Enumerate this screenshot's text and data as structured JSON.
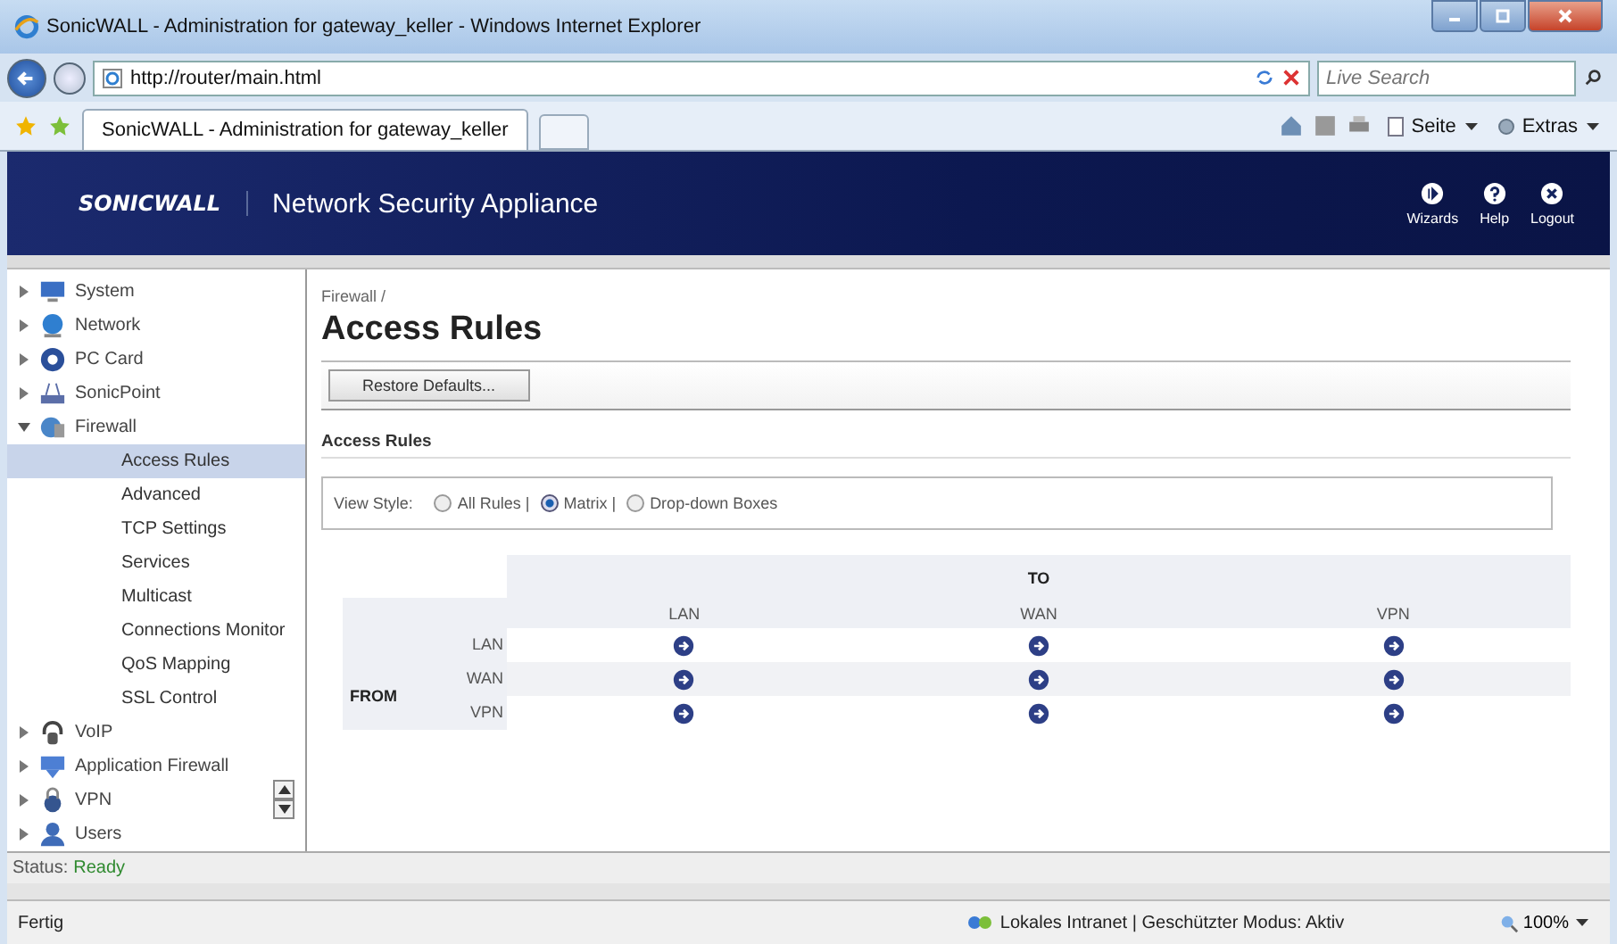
{
  "window": {
    "title": "SonicWALL - Administration for gateway_keller - Windows Internet Explorer"
  },
  "address_bar": {
    "url": "http://router/main.html",
    "search_placeholder": "Live Search"
  },
  "tab": {
    "label": "SonicWALL - Administration for gateway_keller"
  },
  "toolbar": {
    "items": [
      {
        "label": "Seite",
        "kind": "page"
      },
      {
        "label": "Extras",
        "kind": "tools"
      }
    ]
  },
  "app_header": {
    "logo": "SONICWALL",
    "product": "Network Security Appliance",
    "actions": [
      {
        "label": "Wizards",
        "kind": "wizard"
      },
      {
        "label": "Help",
        "kind": "help"
      },
      {
        "label": "Logout",
        "kind": "logout"
      }
    ]
  },
  "sidebar": {
    "items": [
      {
        "label": "System",
        "kind": "monitor",
        "expanded": false,
        "selected": false
      },
      {
        "label": "Network",
        "kind": "globe",
        "expanded": false,
        "selected": false
      },
      {
        "label": "PC Card",
        "kind": "card",
        "expanded": false,
        "selected": false
      },
      {
        "label": "SonicPoint",
        "kind": "router",
        "expanded": false,
        "selected": false
      },
      {
        "label": "Firewall",
        "kind": "wall",
        "expanded": true,
        "selected": false,
        "children": [
          {
            "label": "Access Rules",
            "selected": true
          },
          {
            "label": "Advanced",
            "selected": false
          },
          {
            "label": "TCP Settings",
            "selected": false
          },
          {
            "label": "Services",
            "selected": false
          },
          {
            "label": "Multicast",
            "selected": false
          },
          {
            "label": "Connections Monitor",
            "selected": false
          },
          {
            "label": "QoS Mapping",
            "selected": false
          },
          {
            "label": "SSL Control",
            "selected": false
          }
        ]
      },
      {
        "label": "VoIP",
        "kind": "headset",
        "expanded": false,
        "selected": false
      },
      {
        "label": "Application Firewall",
        "kind": "shield",
        "expanded": false,
        "selected": false
      },
      {
        "label": "VPN",
        "kind": "lock",
        "expanded": false,
        "selected": false
      },
      {
        "label": "Users",
        "kind": "users",
        "expanded": false,
        "selected": false
      }
    ]
  },
  "main": {
    "breadcrumb": "Firewall /",
    "title": "Access Rules",
    "restore_button": "Restore Defaults...",
    "section": "Access Rules",
    "view_style": {
      "label": "View Style:",
      "options": [
        {
          "label": "All Rules |",
          "selected": false
        },
        {
          "label": "Matrix |",
          "selected": true
        },
        {
          "label": "Drop-down Boxes",
          "selected": false
        }
      ]
    },
    "matrix": {
      "to_label": "TO",
      "from_label": "FROM",
      "columns": [
        "LAN",
        "WAN",
        "VPN"
      ],
      "rows": [
        "LAN",
        "WAN",
        "VPN"
      ]
    }
  },
  "app_status": {
    "label": "Status:",
    "value": "Ready"
  },
  "status_bar": {
    "text": "Fertig",
    "zone": "Lokales Intranet | Geschützter Modus: Aktiv",
    "zoom": "100%"
  }
}
